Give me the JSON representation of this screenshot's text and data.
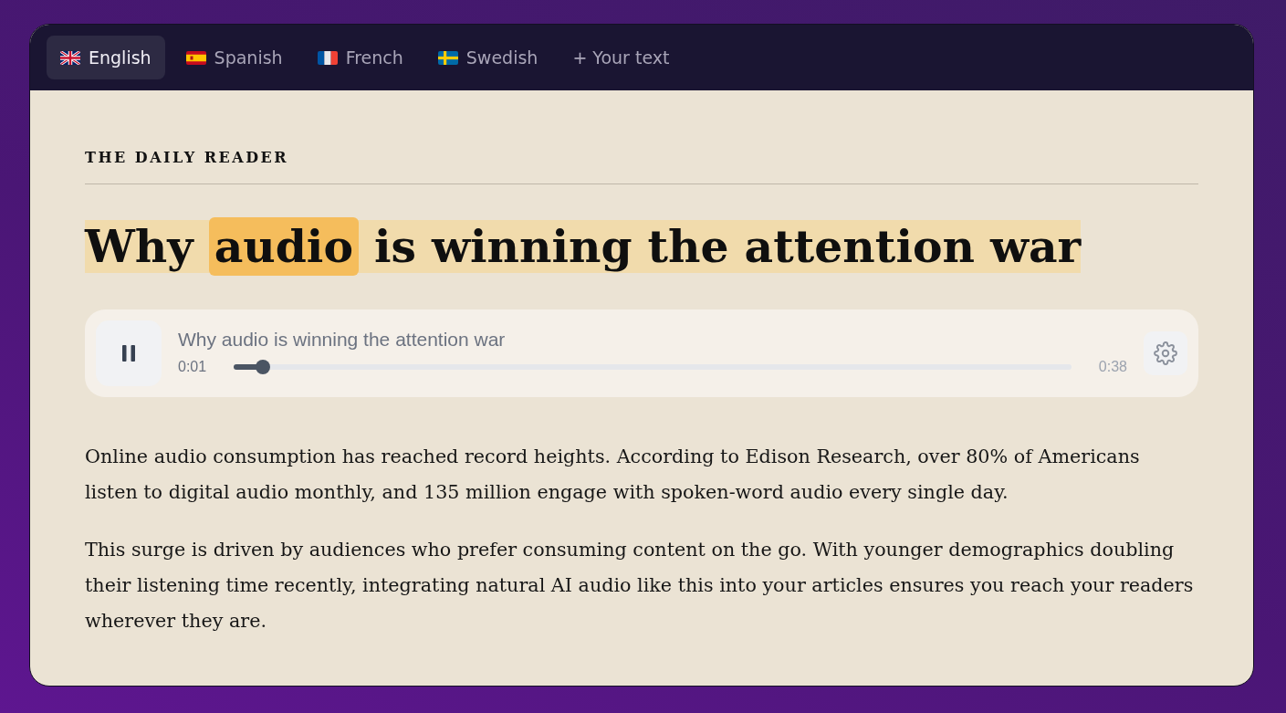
{
  "tabs": [
    {
      "kind": "british",
      "label": "English",
      "selected": true
    },
    {
      "kind": "spanish",
      "label": "Spanish",
      "selected": false
    },
    {
      "kind": "french",
      "label": "French",
      "selected": false
    },
    {
      "kind": "swedish",
      "label": "Swedish",
      "selected": false
    },
    {
      "kind": "custom",
      "label": "+ Your text",
      "selected": false
    }
  ],
  "masthead": "THE DAILY READER",
  "headline": {
    "reading": true,
    "segments": [
      {
        "text": "Why",
        "current": false
      },
      {
        "text": "audio",
        "current": true
      },
      {
        "text": "is winning the attention war",
        "current": false
      }
    ]
  },
  "player": {
    "playing": true,
    "title": "Why audio is winning the attention war",
    "elapsed": "0:01",
    "level": 0.035,
    "duration": "0:38"
  },
  "paragraphs": [
    "Online audio consumption has reached record heights. According to Edison Research, over 80% of Americans listen to digital audio monthly, and 135 million engage with spoken-word audio every single day.",
    "This surge is driven by audiences who prefer consuming content on the go. With younger demographics doubling their listening time recently, integrating natural AI audio like this into your articles ensures you reach your readers wherever they are."
  ]
}
